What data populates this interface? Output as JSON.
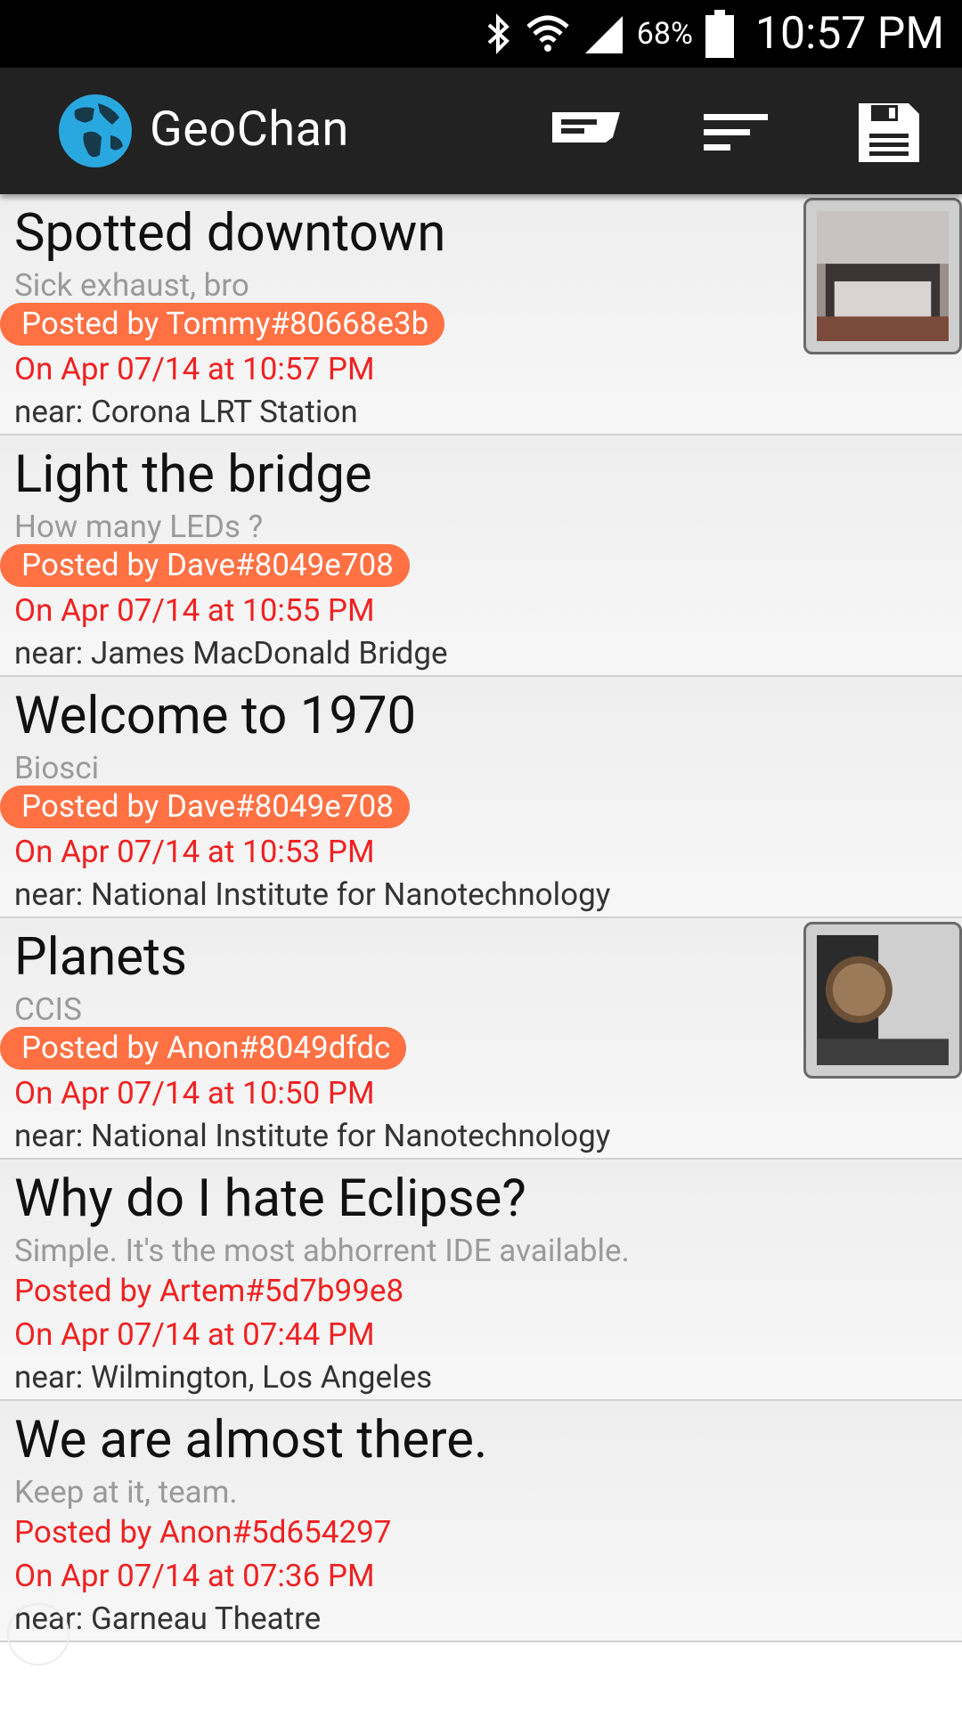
{
  "status_bar": {
    "battery_percent": "68%",
    "time": "10:57 PM",
    "icons": [
      "bluetooth-icon",
      "wifi-icon",
      "signal-icon",
      "battery-icon"
    ]
  },
  "action_bar": {
    "title": "GeoChan",
    "logo_icon": "globe-icon",
    "actions": [
      "new-topic-icon",
      "sort-icon",
      "save-icon"
    ]
  },
  "colors": {
    "action_bar": "#222222",
    "author_pill": "#ff7043",
    "date_text": "#ee2222"
  },
  "posts": [
    {
      "title": "Spotted downtown",
      "subtitle": "Sick exhaust, bro",
      "author": "Posted by Tommy#80668e3b",
      "date": "On Apr 07/14 at 10:57 PM",
      "near": "near: Corona LRT Station",
      "highlighted": true,
      "has_thumbnail": true
    },
    {
      "title": "Light the bridge",
      "subtitle": "How many LEDs ?",
      "author": "Posted by Dave#8049e708",
      "date": "On Apr 07/14 at 10:55 PM",
      "near": "near: James MacDonald Bridge",
      "highlighted": true,
      "has_thumbnail": false
    },
    {
      "title": "Welcome to 1970",
      "subtitle": "Biosci",
      "author": "Posted by Dave#8049e708",
      "date": "On Apr 07/14 at 10:53 PM",
      "near": "near: National Institute for Nanotechnology",
      "highlighted": true,
      "has_thumbnail": false
    },
    {
      "title": "Planets",
      "subtitle": "CCIS",
      "author": "Posted by Anon#8049dfdc",
      "date": "On Apr 07/14 at 10:50 PM",
      "near": "near: National Institute for Nanotechnology",
      "highlighted": true,
      "has_thumbnail": true
    },
    {
      "title": "Why do I hate Eclipse?",
      "subtitle": "Simple. It's the most abhorrent IDE available.",
      "author": "Posted by Artem#5d7b99e8",
      "date": "On Apr 07/14 at 07:44 PM",
      "near": "near: Wilmington, Los Angeles",
      "highlighted": false,
      "has_thumbnail": false
    },
    {
      "title": "We are almost there.",
      "subtitle": "Keep at it, team.",
      "author": "Posted by Anon#5d654297",
      "date": "On Apr 07/14 at 07:36 PM",
      "near": "near: Garneau Theatre",
      "highlighted": false,
      "has_thumbnail": false
    }
  ]
}
